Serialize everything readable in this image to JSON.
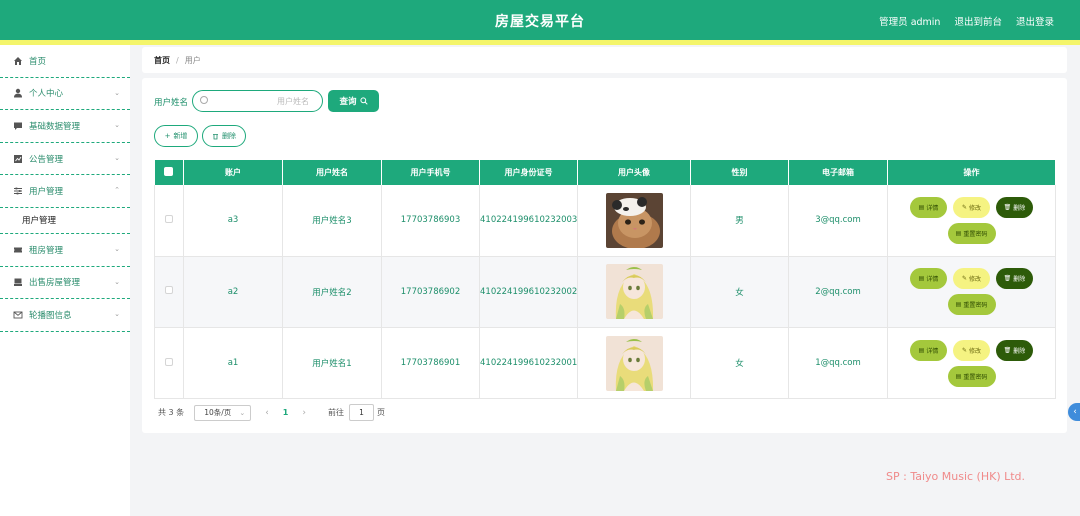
{
  "header": {
    "title": "房屋交易平台",
    "links": [
      "管理员 admin",
      "退出到前台",
      "退出登录"
    ]
  },
  "sidebar": {
    "items": [
      {
        "label": "首页",
        "icon": "home-icon"
      },
      {
        "label": "个人中心",
        "icon": "user-icon"
      },
      {
        "label": "基础数据管理",
        "icon": "chat-icon"
      },
      {
        "label": "公告管理",
        "icon": "chart-icon"
      },
      {
        "label": "用户管理",
        "icon": "sliders-icon"
      },
      {
        "label": "用户管理",
        "icon": ""
      },
      {
        "label": "租房管理",
        "icon": "ticket-icon"
      },
      {
        "label": "出售房屋管理",
        "icon": "house-icon"
      },
      {
        "label": "轮播图信息",
        "icon": "mail-icon"
      }
    ]
  },
  "breadcrumb": {
    "home": "首页",
    "separator": "/",
    "current": "用户"
  },
  "search": {
    "label": "用户姓名",
    "placeholder": "用户姓名",
    "button": "查询"
  },
  "actions": {
    "add": "新增",
    "delete": "删除"
  },
  "table": {
    "headers": [
      "账户",
      "用户姓名",
      "用户手机号",
      "用户身份证号",
      "用户头像",
      "性别",
      "电子邮箱",
      "操作"
    ],
    "rows": [
      {
        "account": "a3",
        "name": "用户姓名3",
        "phone": "17703786903",
        "idcard": "410224199610232003",
        "avatar": "cat-photo",
        "gender": "男",
        "email": "3@qq.com"
      },
      {
        "account": "a2",
        "name": "用户姓名2",
        "phone": "17703786902",
        "idcard": "410224199610232002",
        "avatar": "anime-girl",
        "gender": "女",
        "email": "2@qq.com"
      },
      {
        "account": "a1",
        "name": "用户姓名1",
        "phone": "17703786901",
        "idcard": "410224199610232001",
        "avatar": "anime-girl",
        "gender": "女",
        "email": "1@qq.com"
      }
    ],
    "ops": {
      "view": "详情",
      "edit": "修改",
      "delete": "删除",
      "reset": "重置密码"
    }
  },
  "pagination": {
    "total": "共 3 条",
    "page_size": "10条/页",
    "current": "1",
    "goto_label": "前往",
    "goto_value": "1",
    "page_suffix": "页"
  },
  "watermark": "SP : Taiyo Music (HK) Ltd.",
  "colors": {
    "primary": "#1ea97c",
    "accent_bar": "#f4f56b",
    "view_btn": "#a4c83c",
    "edit_btn": "#f5f382",
    "delete_btn": "#2d5b09"
  }
}
